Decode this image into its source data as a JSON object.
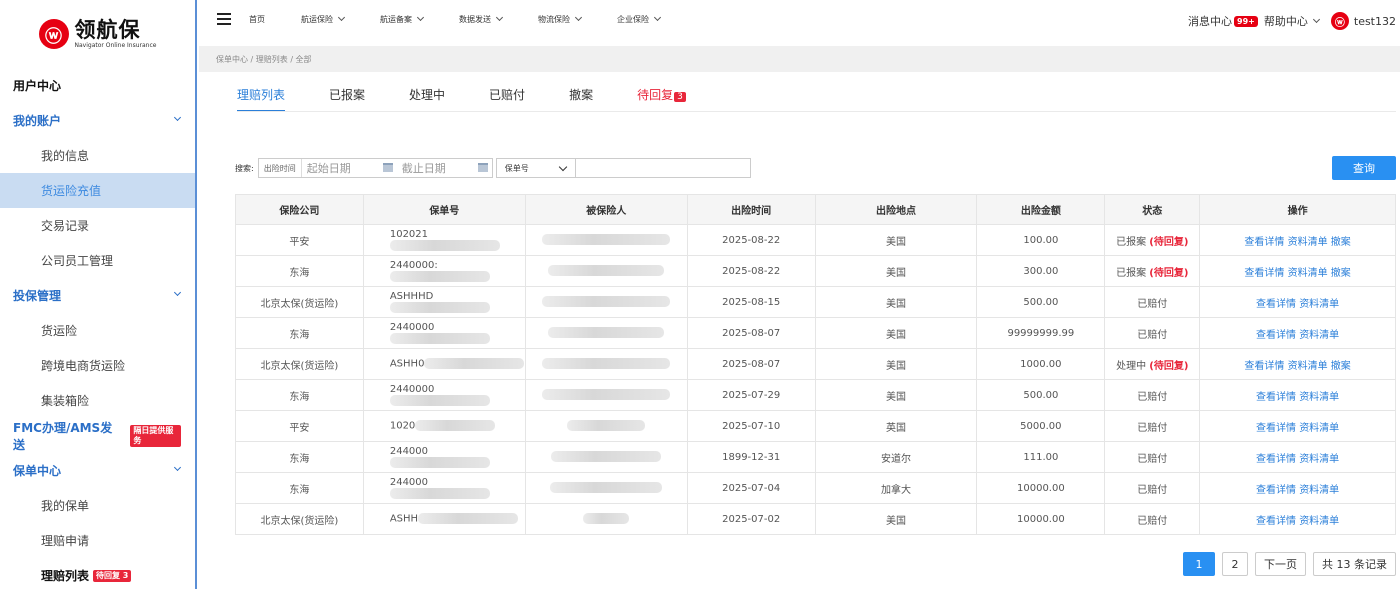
{
  "brand": {
    "logo_char": "ⓦ",
    "name_cn": "领航保",
    "name_en": "Navigator Online Insurance"
  },
  "sidebar": {
    "user_center": "用户中心",
    "my_account": "我的账户",
    "account_items": [
      "我的信息",
      "货运险充值",
      "交易记录",
      "公司员工管理"
    ],
    "insure_mgmt": "投保管理",
    "insure_items": [
      "货运险",
      "跨境电商货运险",
      "集装箱险"
    ],
    "fmc": "FMC办理/AMS发送",
    "fmc_tag": "隔日提供服务",
    "policy_center": "保单中心",
    "policy_items": [
      "我的保单",
      "理赔申请"
    ],
    "claims_list": "理赔列表",
    "claims_tag": "待回复 3"
  },
  "topbar": {
    "nav": [
      "首页",
      "航运保险",
      "航运备案",
      "数据发送",
      "物流保险",
      "企业保险"
    ],
    "messages": "消息中心",
    "messages_badge": "99+",
    "help": "帮助中心",
    "user": "test132"
  },
  "breadcrumb": "保单中心  /  理赔列表  /  全部",
  "tabs": [
    "理赔列表",
    "已报案",
    "处理中",
    "已赔付",
    "撤案",
    "待回复"
  ],
  "tab_badge": "3",
  "search": {
    "label": "搜索:",
    "time_label": "出险时间",
    "start_placeholder": "起始日期",
    "end_placeholder": "截止日期",
    "select_value": "保单号",
    "query": "查询"
  },
  "table": {
    "headers": [
      "保险公司",
      "保单号",
      "被保险人",
      "出险时间",
      "出险地点",
      "出险金额",
      "状态",
      "操作"
    ],
    "rows": [
      {
        "company": "平安",
        "policy": "102021",
        "date": "2025-08-22",
        "place": "美国",
        "amount": "100.00",
        "status": "已报案",
        "pending": "(待回复)",
        "op1": "查看详情",
        "op2": "资料清单",
        "op3": "撤案"
      },
      {
        "company": "东海",
        "policy": "2440000:",
        "date": "2025-08-22",
        "place": "美国",
        "amount": "300.00",
        "status": "已报案",
        "pending": "(待回复)",
        "op1": "查看详情",
        "op2": "资料清单",
        "op3": "撤案"
      },
      {
        "company": "北京太保(货运险)",
        "policy": "ASHHHD",
        "date": "2025-08-15",
        "place": "美国",
        "amount": "500.00",
        "status": "已赔付",
        "pending": "",
        "op1": "查看详情",
        "op2": "资料清单",
        "op3": ""
      },
      {
        "company": "东海",
        "policy": "2440000",
        "date": "2025-08-07",
        "place": "美国",
        "amount": "99999999.99",
        "status": "已赔付",
        "pending": "",
        "op1": "查看详情",
        "op2": "资料清单",
        "op3": ""
      },
      {
        "company": "北京太保(货运险)",
        "policy": "ASHH0",
        "date": "2025-08-07",
        "place": "美国",
        "amount": "1000.00",
        "status": "处理中",
        "pending": "(待回复)",
        "op1": "查看详情",
        "op2": "资料清单",
        "op3": "撤案"
      },
      {
        "company": "东海",
        "policy": "2440000",
        "date": "2025-07-29",
        "place": "美国",
        "amount": "500.00",
        "status": "已赔付",
        "pending": "",
        "op1": "查看详情",
        "op2": "资料清单",
        "op3": ""
      },
      {
        "company": "平安",
        "policy": "1020",
        "date": "2025-07-10",
        "place": "英国",
        "amount": "5000.00",
        "status": "已赔付",
        "pending": "",
        "op1": "查看详情",
        "op2": "资料清单",
        "op3": ""
      },
      {
        "company": "东海",
        "policy": "244000",
        "date": "1899-12-31",
        "place": "安道尔",
        "amount": "111.00",
        "status": "已赔付",
        "pending": "",
        "op1": "查看详情",
        "op2": "资料清单",
        "op3": ""
      },
      {
        "company": "东海",
        "policy": "244000",
        "date": "2025-07-04",
        "place": "加拿大",
        "amount": "10000.00",
        "status": "已赔付",
        "pending": "",
        "op1": "查看详情",
        "op2": "资料清单",
        "op3": ""
      },
      {
        "company": "北京太保(货运险)",
        "policy": "ASHH",
        "date": "2025-07-02",
        "place": "美国",
        "amount": "10000.00",
        "status": "已赔付",
        "pending": "",
        "op1": "查看详情",
        "op2": "资料清单",
        "op3": ""
      }
    ]
  },
  "pager": {
    "p1": "1",
    "p2": "2",
    "next": "下一页",
    "total": "共 13 条记录"
  }
}
